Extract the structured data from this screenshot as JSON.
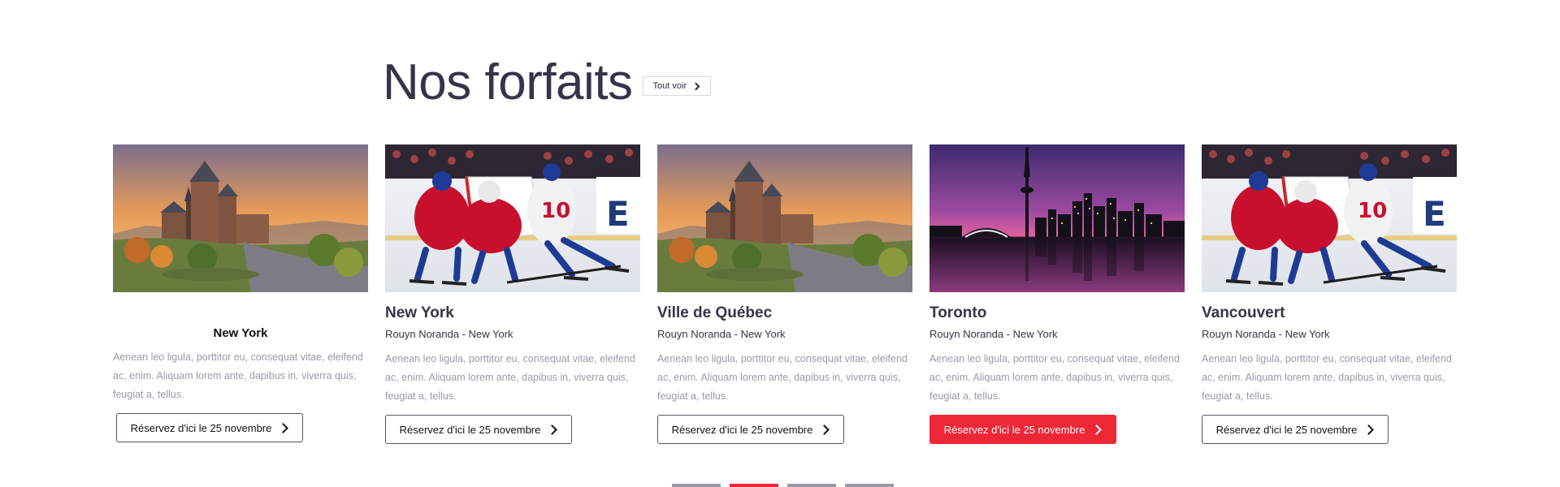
{
  "section": {
    "title": "Nos forfaits",
    "see_all_label": "Tout voir",
    "see_all_icon": "chevron-right-icon"
  },
  "cards": [
    {
      "image": "quebec-chateau-sunset",
      "title": "New York",
      "subtitle": "",
      "description": "Aenean leo ligula, porttitor eu, consequat vitae, eleifend ac, enim. Aliquam lorem ante, dapibus in, viverra quis, feugiat a, tellus.",
      "cta": "Réservez d'ici le 25 novembre",
      "cta_active": false
    },
    {
      "image": "hockey-game",
      "title": "New York",
      "subtitle": "Rouyn Noranda - New York",
      "description": "Aenean leo ligula, porttitor eu, consequat vitae, eleifend ac, enim. Aliquam lorem ante, dapibus in, viverra quis, feugiat a, tellus.",
      "cta": "Réservez d'ici le 25 novembre",
      "cta_active": false
    },
    {
      "image": "quebec-chateau-sunset",
      "title": "Ville de Québec",
      "subtitle": "Rouyn Noranda - New York",
      "description": "Aenean leo ligula, porttitor eu, consequat vitae, eleifend ac, enim. Aliquam lorem ante, dapibus in, viverra quis, feugiat a, tellus.",
      "cta": "Réservez d'ici le 25 novembre",
      "cta_active": false
    },
    {
      "image": "toronto-skyline-night",
      "title": "Toronto",
      "subtitle": "Rouyn Noranda - New York",
      "description": "Aenean leo ligula, porttitor eu, consequat vitae, eleifend ac, enim. Aliquam lorem ante, dapibus in, viverra quis, feugiat a, tellus.",
      "cta": "Réservez d'ici le 25 novembre",
      "cta_active": true
    },
    {
      "image": "hockey-game",
      "title": "Vancouvert",
      "subtitle": "Rouyn Noranda - New York",
      "description": "Aenean leo ligula, porttitor eu, consequat vitae, eleifend ac, enim. Aliquam lorem ante, dapibus in, viverra quis, feugiat a, tellus.",
      "cta": "Réservez d'ici le 25 novembre",
      "cta_active": false
    }
  ],
  "pagination": {
    "count": 4,
    "active_index": 1
  },
  "colors": {
    "accent": "#ee2737",
    "heading": "#35344a",
    "muted": "#9b9aa8",
    "dot": "#9a99a8"
  }
}
